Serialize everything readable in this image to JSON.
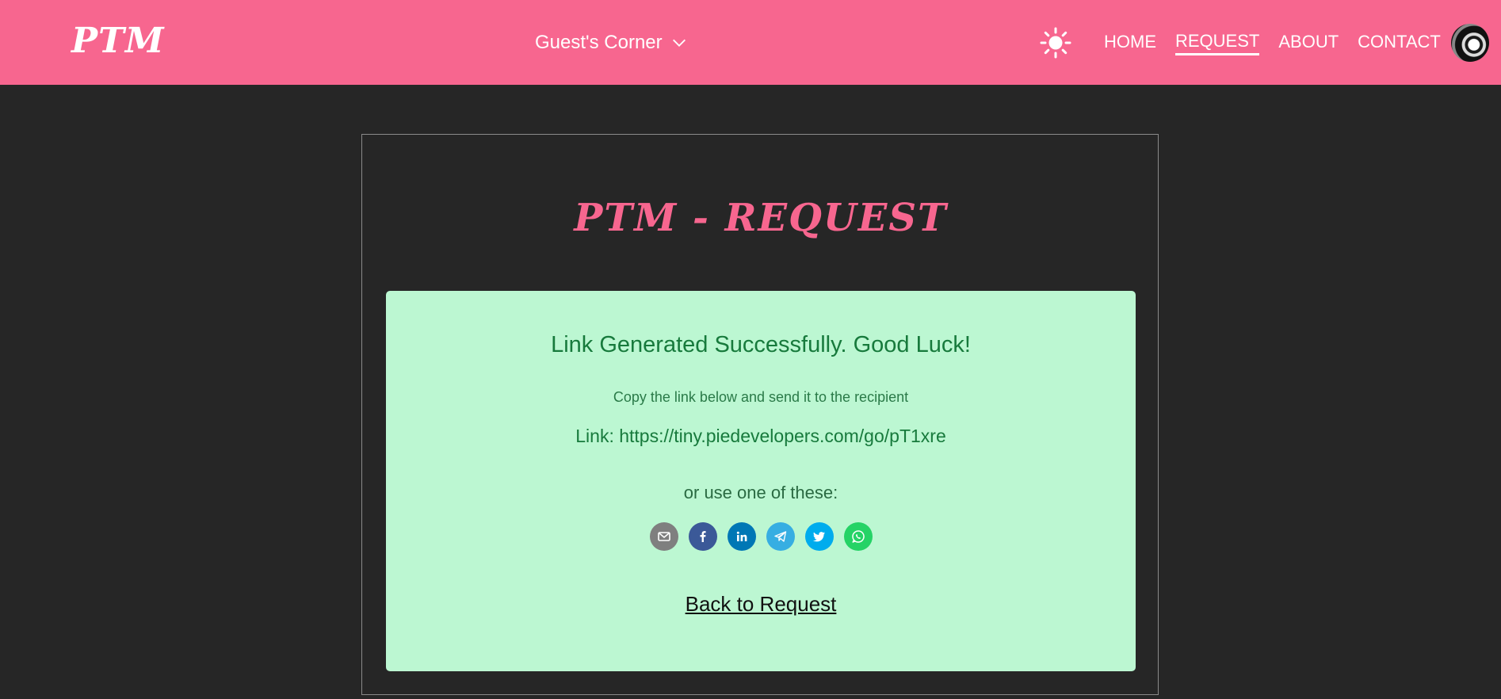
{
  "header": {
    "brand": "PTM",
    "guest_menu_label": "Guest's Corner",
    "nav": [
      {
        "label": "HOME",
        "active": false
      },
      {
        "label": "REQUEST",
        "active": true
      },
      {
        "label": "ABOUT",
        "active": false
      },
      {
        "label": "CONTACT",
        "active": false
      }
    ],
    "icons": {
      "theme": "sun-icon",
      "dropdown": "chevron-down-icon",
      "avatar": "user-avatar"
    }
  },
  "main": {
    "title": "PTM - REQUEST",
    "success": {
      "heading": "Link Generated Successfully. Good Luck!",
      "subtext": "Copy the link below and send it to the recipient",
      "link_text": "Link: https://tiny.piedevelopers.com/go/pT1xre",
      "or_text": "or use one of these:",
      "share": [
        {
          "name": "email",
          "icon": "email-icon",
          "color": "#7f7f7f"
        },
        {
          "name": "facebook",
          "icon": "facebook-icon",
          "color": "#3b5998"
        },
        {
          "name": "linkedin",
          "icon": "linkedin-icon",
          "color": "#0077b5"
        },
        {
          "name": "telegram",
          "icon": "telegram-icon",
          "color": "#37aee2"
        },
        {
          "name": "twitter",
          "icon": "twitter-icon",
          "color": "#00aced"
        },
        {
          "name": "whatsapp",
          "icon": "whatsapp-icon",
          "color": "#25d366"
        }
      ],
      "back_label": "Back to Request"
    }
  },
  "colors": {
    "accent": "#f7668f",
    "background": "#262626",
    "success_bg": "#bcf7d2",
    "success_text": "#177a3c"
  }
}
